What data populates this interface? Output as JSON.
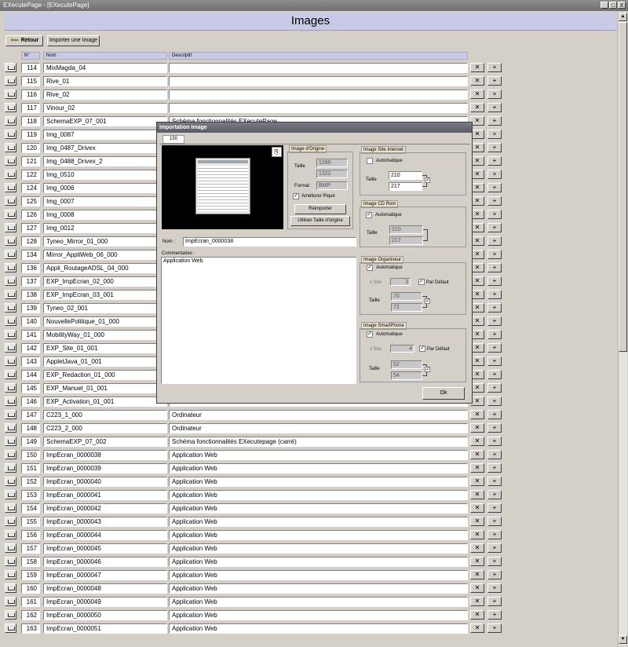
{
  "window": {
    "title": "EXecutePage - [EXecutePage]",
    "controls": [
      "_",
      "□",
      "X"
    ]
  },
  "page_title": "Images",
  "toolbar": {
    "back_label": "Retour",
    "import_label": "Importer une Image"
  },
  "columns": {
    "num": "N°",
    "name": "Nom",
    "description": "Descriptif"
  },
  "row_buttons": {
    "delete": "✕",
    "add": "+"
  },
  "rows": [
    {
      "num": "114",
      "name": "MixMagda_04",
      "desc": ""
    },
    {
      "num": "115",
      "name": "Rive_01",
      "desc": ""
    },
    {
      "num": "116",
      "name": "Rive_02",
      "desc": ""
    },
    {
      "num": "117",
      "name": "Vinour_02",
      "desc": ""
    },
    {
      "num": "118",
      "name": "SchemaEXP_07_001",
      "desc": "Schéma fonctionnalités EXecutePage"
    },
    {
      "num": "119",
      "name": "Img_0087",
      "desc": ""
    },
    {
      "num": "120",
      "name": "Img_0487_Drivex",
      "desc": ""
    },
    {
      "num": "121",
      "name": "Img_0488_Drivex_2",
      "desc": ""
    },
    {
      "num": "122",
      "name": "Img_0510",
      "desc": ""
    },
    {
      "num": "124",
      "name": "Img_0006",
      "desc": ""
    },
    {
      "num": "125",
      "name": "Img_0007",
      "desc": ""
    },
    {
      "num": "126",
      "name": "Img_0008",
      "desc": ""
    },
    {
      "num": "127",
      "name": "Img_0012",
      "desc": ""
    },
    {
      "num": "128",
      "name": "Tyneo_Mirror_01_000",
      "desc": ""
    },
    {
      "num": "134",
      "name": "Mirror_AppliWeb_06_000",
      "desc": ""
    },
    {
      "num": "136",
      "name": "Appli_RoutageADSL_04_000",
      "desc": ""
    },
    {
      "num": "137",
      "name": "EXP_ImpEcran_02_000",
      "desc": ""
    },
    {
      "num": "138",
      "name": "EXP_ImpEcran_03_001",
      "desc": ""
    },
    {
      "num": "139",
      "name": "Tyneo_02_001",
      "desc": ""
    },
    {
      "num": "140",
      "name": "NouvellePolitique_01_000",
      "desc": ""
    },
    {
      "num": "141",
      "name": "MobilityWay_01_000",
      "desc": ""
    },
    {
      "num": "142",
      "name": "EXP_Site_01_001",
      "desc": ""
    },
    {
      "num": "143",
      "name": "AppletJava_01_001",
      "desc": ""
    },
    {
      "num": "144",
      "name": "EXP_Redaction_01_000",
      "desc": ""
    },
    {
      "num": "145",
      "name": "EXP_Manuel_01_001",
      "desc": ""
    },
    {
      "num": "146",
      "name": "EXP_Activation_01_001",
      "desc": ""
    },
    {
      "num": "147",
      "name": "C223_1_000",
      "desc": "Ordinateur"
    },
    {
      "num": "148",
      "name": "C223_2_000",
      "desc": "Ordinateur"
    },
    {
      "num": "149",
      "name": "SchemaEXP_07_002",
      "desc": "Schéma fonctionnalités EXecutepage (carré)"
    },
    {
      "num": "150",
      "name": "ImpEcran_0000038",
      "desc": "Application Web"
    },
    {
      "num": "151",
      "name": "ImpEcran_0000039",
      "desc": "Application Web"
    },
    {
      "num": "152",
      "name": "ImpEcran_0000040",
      "desc": "Application Web"
    },
    {
      "num": "153",
      "name": "ImpEcran_0000041",
      "desc": "Application Web"
    },
    {
      "num": "154",
      "name": "ImpEcran_0000042",
      "desc": "Application Web"
    },
    {
      "num": "155",
      "name": "ImpEcran_0000043",
      "desc": "Application Web"
    },
    {
      "num": "156",
      "name": "ImpEcran_0000044",
      "desc": "Application Web"
    },
    {
      "num": "157",
      "name": "ImpEcran_0000045",
      "desc": "Application Web"
    },
    {
      "num": "158",
      "name": "ImpEcran_0000046",
      "desc": "Application Web"
    },
    {
      "num": "159",
      "name": "ImpEcran_0000047",
      "desc": "Application Web"
    },
    {
      "num": "160",
      "name": "ImpEcran_0000048",
      "desc": "Application Web"
    },
    {
      "num": "161",
      "name": "ImpEcran_0000049",
      "desc": "Application Web"
    },
    {
      "num": "162",
      "name": "ImpEcran_0000050",
      "desc": "Application Web"
    },
    {
      "num": "163",
      "name": "ImpEcran_0000051",
      "desc": "Application Web"
    }
  ],
  "dialog": {
    "title": "Importation Image",
    "tab": "150",
    "origin": {
      "title": "Image d'Origine",
      "size_label": "Taille",
      "width": "1280",
      "height": "1322",
      "format_label": "Format",
      "format": "BMP",
      "improve_label": "Améliorer Piqué",
      "reimport_label": "Réimporter",
      "use_size_label": "Utiliser Taille d'origine"
    },
    "name_label": "Nom :",
    "name_value": "ImpEcran_0000038",
    "comments_label": "Commentaires :",
    "comments_value": "Application Web",
    "site": {
      "title": "Image Site Internet",
      "auto_label": "Automatique",
      "size_label": "Taille",
      "width": "210",
      "height": "217"
    },
    "cdrom": {
      "title": "Image CD Rom",
      "auto_label": "Automatique",
      "size_label": "Taille",
      "width": "210",
      "height": "217"
    },
    "organizer": {
      "title": "Image Organiseur",
      "ratio_label": "x Site",
      "ratio": "3",
      "default_label": "Par Défaut",
      "size_label": "Taille",
      "width": "70",
      "height": "72"
    },
    "smartphone": {
      "title": "Image SmartPhone",
      "auto_label": "Automatique",
      "ratio_label": "x Site",
      "ratio": "4",
      "default_label": "Par Défaut",
      "size_label": "Taille",
      "width": "52",
      "height": "54"
    },
    "ok_label": "Ok"
  },
  "check_mark": "✓"
}
